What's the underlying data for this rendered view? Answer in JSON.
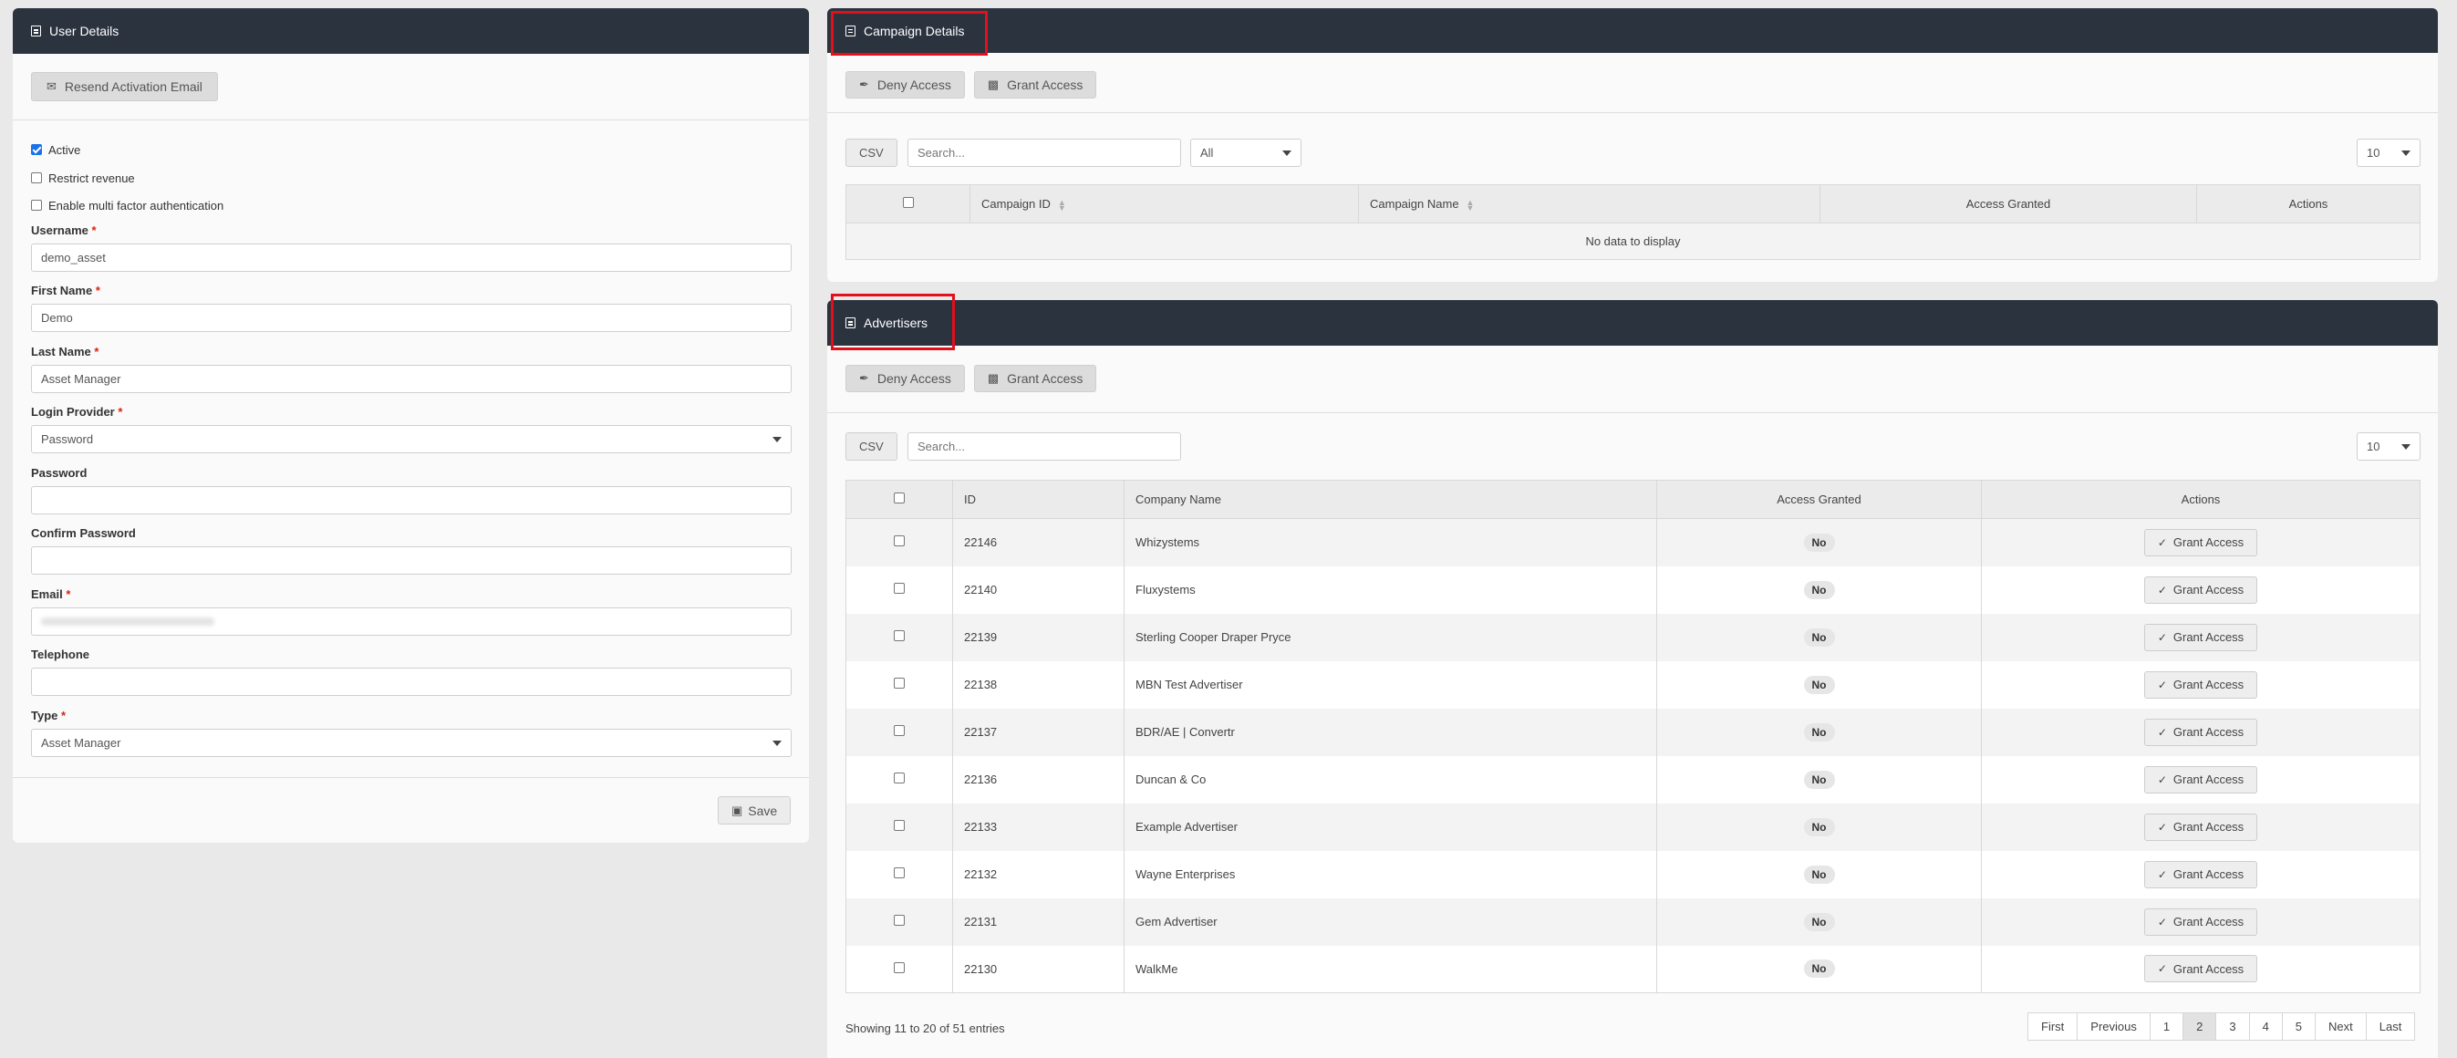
{
  "user_details": {
    "title": "User Details",
    "resend_button": "Resend Activation Email",
    "checkboxes": [
      {
        "label": "Active",
        "checked": true
      },
      {
        "label": "Restrict revenue",
        "checked": false
      },
      {
        "label": "Enable multi factor authentication",
        "checked": false
      }
    ],
    "fields": {
      "username": {
        "label": "Username",
        "value": "demo_asset"
      },
      "first_name": {
        "label": "First Name",
        "value": "Demo"
      },
      "last_name": {
        "label": "Last Name",
        "value": "Asset Manager"
      },
      "login_provider": {
        "label": "Login Provider",
        "value": "Password"
      },
      "password": {
        "label": "Password",
        "value": ""
      },
      "confirm_password": {
        "label": "Confirm Password",
        "value": ""
      },
      "email": {
        "label": "Email",
        "value": ""
      },
      "telephone": {
        "label": "Telephone",
        "value": ""
      },
      "type": {
        "label": "Type",
        "value": "Asset Manager"
      }
    },
    "required_mark": "*",
    "save_button": "Save"
  },
  "campaign_details": {
    "title": "Campaign Details",
    "deny_button": "Deny Access",
    "grant_button": "Grant Access",
    "csv_button": "CSV",
    "search_placeholder": "Search...",
    "filter_value": "All",
    "page_size": "10",
    "columns": [
      "Campaign ID",
      "Campaign Name",
      "Access Granted",
      "Actions"
    ],
    "empty_text": "No data to display"
  },
  "advertisers": {
    "title": "Advertisers",
    "deny_button": "Deny Access",
    "grant_button": "Grant Access",
    "csv_button": "CSV",
    "search_placeholder": "Search...",
    "page_size": "10",
    "columns": [
      "ID",
      "Company Name",
      "Access Granted",
      "Actions"
    ],
    "rows": [
      {
        "id": "22146",
        "company": "Whizystems",
        "access": "No",
        "action": "Grant Access"
      },
      {
        "id": "22140",
        "company": "Fluxystems",
        "access": "No",
        "action": "Grant Access"
      },
      {
        "id": "22139",
        "company": "Sterling Cooper Draper Pryce",
        "access": "No",
        "action": "Grant Access"
      },
      {
        "id": "22138",
        "company": "MBN Test Advertiser",
        "access": "No",
        "action": "Grant Access"
      },
      {
        "id": "22137",
        "company": "BDR/AE | Convertr",
        "access": "No",
        "action": "Grant Access"
      },
      {
        "id": "22136",
        "company": "Duncan & Co",
        "access": "No",
        "action": "Grant Access"
      },
      {
        "id": "22133",
        "company": "Example Advertiser",
        "access": "No",
        "action": "Grant Access"
      },
      {
        "id": "22132",
        "company": "Wayne Enterprises",
        "access": "No",
        "action": "Grant Access"
      },
      {
        "id": "22131",
        "company": "Gem Advertiser",
        "access": "No",
        "action": "Grant Access"
      },
      {
        "id": "22130",
        "company": "WalkMe",
        "access": "No",
        "action": "Grant Access"
      }
    ],
    "showing_text": "Showing 11 to 20 of 51 entries",
    "pagination": [
      "First",
      "Previous",
      "1",
      "2",
      "3",
      "4",
      "5",
      "Next",
      "Last"
    ],
    "active_page": "2"
  },
  "colors": {
    "header_bg": "#2b333e",
    "highlight": "#e3101b",
    "checkbox_checked": "#1a73e8"
  }
}
